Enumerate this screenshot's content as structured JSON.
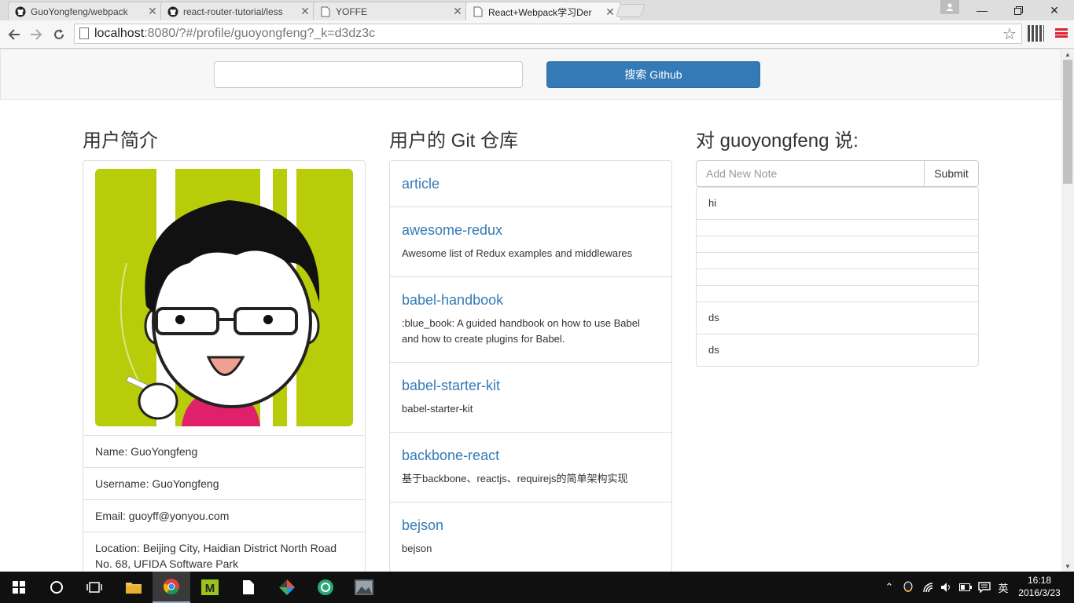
{
  "browser": {
    "tabs": [
      {
        "title": "GuoYongfeng/webpack",
        "icon": "github-icon",
        "active": false
      },
      {
        "title": "react-router-tutorial/less",
        "icon": "github-icon",
        "active": false
      },
      {
        "title": "YOFFE",
        "icon": "page-icon",
        "active": false
      },
      {
        "title": "React+Webpack学习Der",
        "icon": "page-icon",
        "active": true
      }
    ],
    "url_host": "localhost",
    "url_rest": ":8080/?#/profile/guoyongfeng?_k=d3dz3c"
  },
  "search": {
    "placeholder": "",
    "button_label": "搜索 Github"
  },
  "profile": {
    "heading": "用户简介",
    "name": "Name: GuoYongfeng",
    "username": "Username: GuoYongfeng",
    "email": "Email: guoyff@yonyou.com",
    "location": "Location: Beijing City, Haidian District North Road No. 68, UFIDA Software Park",
    "avatar_colors": {
      "background": "#b8cc0a",
      "stripe": "#ffffff",
      "shirt": "#e0206a"
    }
  },
  "repos": {
    "heading": "用户的 Git 仓库",
    "items": [
      {
        "name": "article",
        "description": ""
      },
      {
        "name": "awesome-redux",
        "description": "Awesome list of Redux examples and middlewares"
      },
      {
        "name": "babel-handbook",
        "description": ":blue_book: A guided handbook on how to use Babel and how to create plugins for Babel."
      },
      {
        "name": "babel-starter-kit",
        "description": "babel-starter-kit"
      },
      {
        "name": "backbone-react",
        "description": "基于backbone、reactjs、requirejs的简单架构实现"
      },
      {
        "name": "bejson",
        "description": "bejson"
      }
    ]
  },
  "notes": {
    "heading": "对 guoyongfeng 说:",
    "input_placeholder": "Add New Note",
    "submit_label": "Submit",
    "items": [
      "hi",
      "",
      "",
      "",
      "",
      "",
      "ds",
      "ds"
    ]
  },
  "taskbar": {
    "time": "16:18",
    "date": "2016/3/23",
    "ime": "英"
  },
  "colors": {
    "link": "#337ab7",
    "primary_button": "#337ab7"
  }
}
